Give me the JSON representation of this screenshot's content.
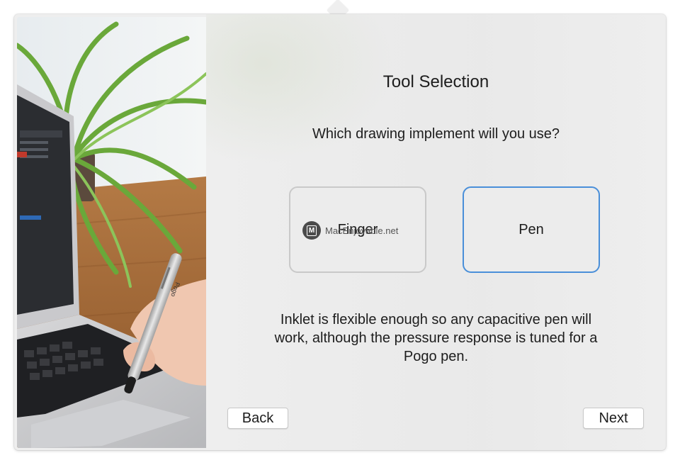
{
  "dialog": {
    "title": "Tool Selection",
    "question": "Which drawing implement will you use?",
    "options": [
      {
        "label": "Finger",
        "selected": false
      },
      {
        "label": "Pen",
        "selected": true
      }
    ],
    "description": "Inklet is flexible enough so any capacitive pen will work, although the pressure response is tuned for a Pogo pen.",
    "buttons": {
      "back": "Back",
      "next": "Next"
    }
  },
  "watermark": {
    "text": "MacEnjoyable.net",
    "badge": "M"
  },
  "photo": {
    "pen_brand": "Pogo"
  },
  "colors": {
    "selected_border": "#4a8fd9",
    "unselected_border": "#c9c9c9",
    "panel_background": "#eeeeee"
  },
  "icons": [
    "macenjoy-badge-icon"
  ]
}
